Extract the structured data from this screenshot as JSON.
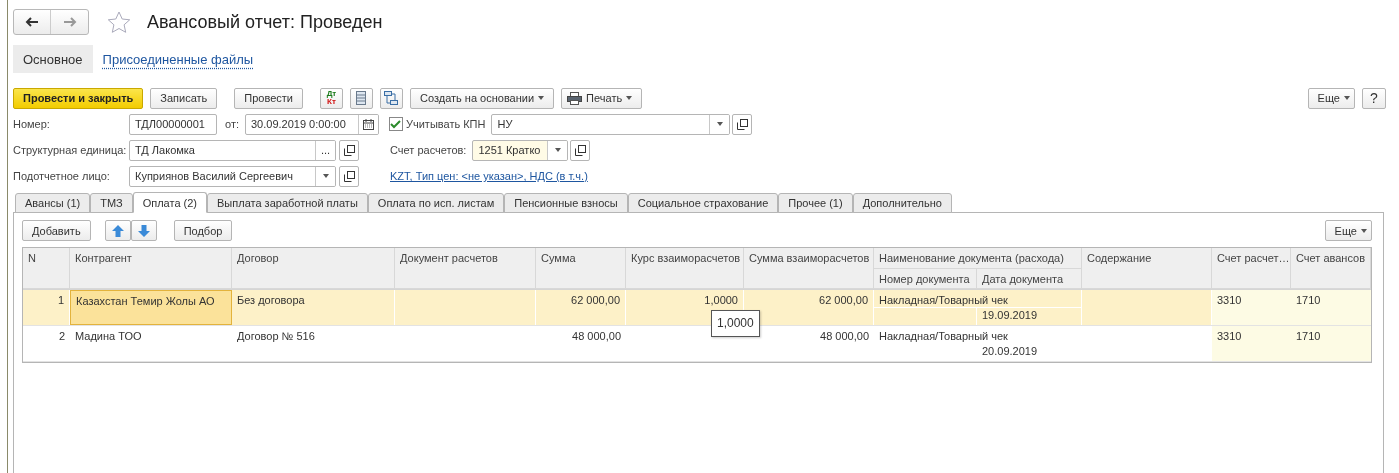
{
  "window": {
    "title": "Авансовый отчет: Проведен",
    "favorite": false
  },
  "sections": [
    {
      "label": "Основное",
      "selected": true
    },
    {
      "label": "Присоединенные файлы",
      "selected": false
    }
  ],
  "commands": [
    {
      "kind": "primary",
      "label": "Провести и закрыть"
    },
    {
      "kind": "button",
      "label": "Записать"
    },
    {
      "kind": "button",
      "label": "Провести"
    },
    {
      "kind": "dtkt",
      "lines": [
        "Дт",
        "Кт"
      ]
    },
    {
      "kind": "list"
    },
    {
      "kind": "structure"
    },
    {
      "kind": "menu",
      "label": "Создать на основании"
    },
    {
      "kind": "print",
      "label": "Печать"
    }
  ],
  "more_button": "Еще",
  "help_button": "?",
  "form": {
    "number": {
      "label": "Номер:",
      "value": "ТДЛ00000001"
    },
    "date": {
      "label": "от:",
      "value": "30.09.2019  0:00:00"
    },
    "kpn": {
      "label": "Учитывать КПН",
      "checked": true,
      "value": "НУ"
    },
    "unit": {
      "label": "Структурная единица:",
      "value": "ТД Лакомка",
      "select_button": "..."
    },
    "account": {
      "label": "Счет расчетов:",
      "value": "1251 Кратко"
    },
    "person": {
      "label": "Подотчетное лицо:",
      "value": "Куприянов Василий Сергеевич"
    },
    "prices_link": "KZT, Тип цен: <не указан>, НДС (в т.ч.)"
  },
  "tabs": [
    {
      "label": "Авансы (1)",
      "selected": false
    },
    {
      "label": "ТМЗ",
      "selected": false
    },
    {
      "label": "Оплата (2)",
      "selected": true
    },
    {
      "label": "Выплата заработной платы",
      "selected": false
    },
    {
      "label": "Оплата по исп. листам",
      "selected": false
    },
    {
      "label": "Пенсионные взносы",
      "selected": false
    },
    {
      "label": "Социальное страхование",
      "selected": false
    },
    {
      "label": "Прочее (1)",
      "selected": false
    },
    {
      "label": "Дополнительно",
      "selected": false
    }
  ],
  "table_toolbar": {
    "add": "Добавить",
    "pick": "Подбор",
    "more": "Еще"
  },
  "table": {
    "columns": [
      {
        "label": "N"
      },
      {
        "label": "Контрагент"
      },
      {
        "label": "Договор"
      },
      {
        "label": "Документ расчетов"
      },
      {
        "label": "Сумма"
      },
      {
        "label": "Курс взаиморасчетов"
      },
      {
        "label": "Сумма взаиморасчетов"
      },
      {
        "label": "Наименование документа (расхода)",
        "sub": [
          "Номер документа",
          "Дата документа"
        ]
      },
      {
        "label": "Содержание"
      },
      {
        "label": "Счет расчет…",
        "tinted": true
      },
      {
        "label": "Счет авансов",
        "tinted": true
      }
    ],
    "rows": [
      {
        "selected": true,
        "n": "1",
        "counterparty": "Казахстан Темир Жолы АО",
        "contract": "Без договора",
        "amount": "62 000,00",
        "rate": "1,0000",
        "settlement_amount": "62 000,00",
        "doc_name": "Накладная/Товарный чек",
        "doc_date": "19.09.2019",
        "account": "3310",
        "advance_account": "1710"
      },
      {
        "selected": false,
        "n": "2",
        "counterparty": "Мадина ТОО",
        "contract": "Договор № 516",
        "amount": "48 000,00",
        "settlement_amount": "48 000,00",
        "doc_name": "Накладная/Товарный чек",
        "doc_date": "20.09.2019",
        "account": "3310",
        "advance_account": "1710"
      }
    ]
  },
  "tooltip": "1,0000"
}
